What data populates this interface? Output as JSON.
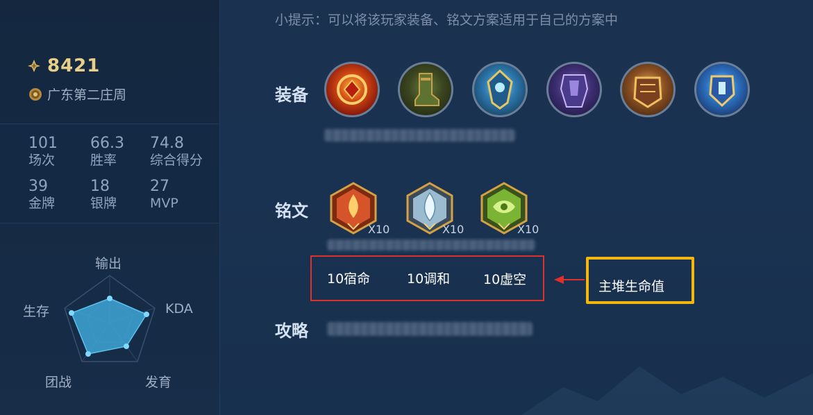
{
  "profile": {
    "rating": "8421",
    "title": "广东第二庄周"
  },
  "stats": [
    {
      "value": "101",
      "label": "场次"
    },
    {
      "value": "66.3",
      "label": "胜率"
    },
    {
      "value": "74.8",
      "label": "综合得分"
    },
    {
      "value": "39",
      "label": "金牌"
    },
    {
      "value": "18",
      "label": "银牌"
    },
    {
      "value": "27",
      "label": "MVP"
    }
  ],
  "radar": {
    "labels": {
      "top": "输出",
      "right": "KDA",
      "bottom_right": "发育",
      "bottom_left": "团战",
      "left": "生存"
    },
    "fill_color": "#3fa6d6"
  },
  "tip": "小提示：可以将该玩家装备、铭文方案适用于自己的方案中",
  "sections": {
    "equipment": "装备",
    "runes": "铭文",
    "guide": "攻略"
  },
  "equipment_icons": [
    "red-gold-shield-icon",
    "green-armor-boot-icon",
    "blue-gold-crest-icon",
    "purple-armor-icon",
    "bronze-armor-icon",
    "blue-gold-helm-icon"
  ],
  "runes": [
    {
      "icon": "red-rune-icon",
      "count": "X10",
      "color": "#d5542a"
    },
    {
      "icon": "blue-rune-icon",
      "count": "X10",
      "color": "#9bbcd0"
    },
    {
      "icon": "green-rune-icon",
      "count": "X10",
      "color": "#7bb334"
    }
  ],
  "rune_names": [
    "10宿命",
    "10调和",
    "10虚空"
  ],
  "annotation": {
    "text": "主堆生命值",
    "red_box_color": "#e0302c",
    "yellow_box_color": "#f3b70e"
  }
}
